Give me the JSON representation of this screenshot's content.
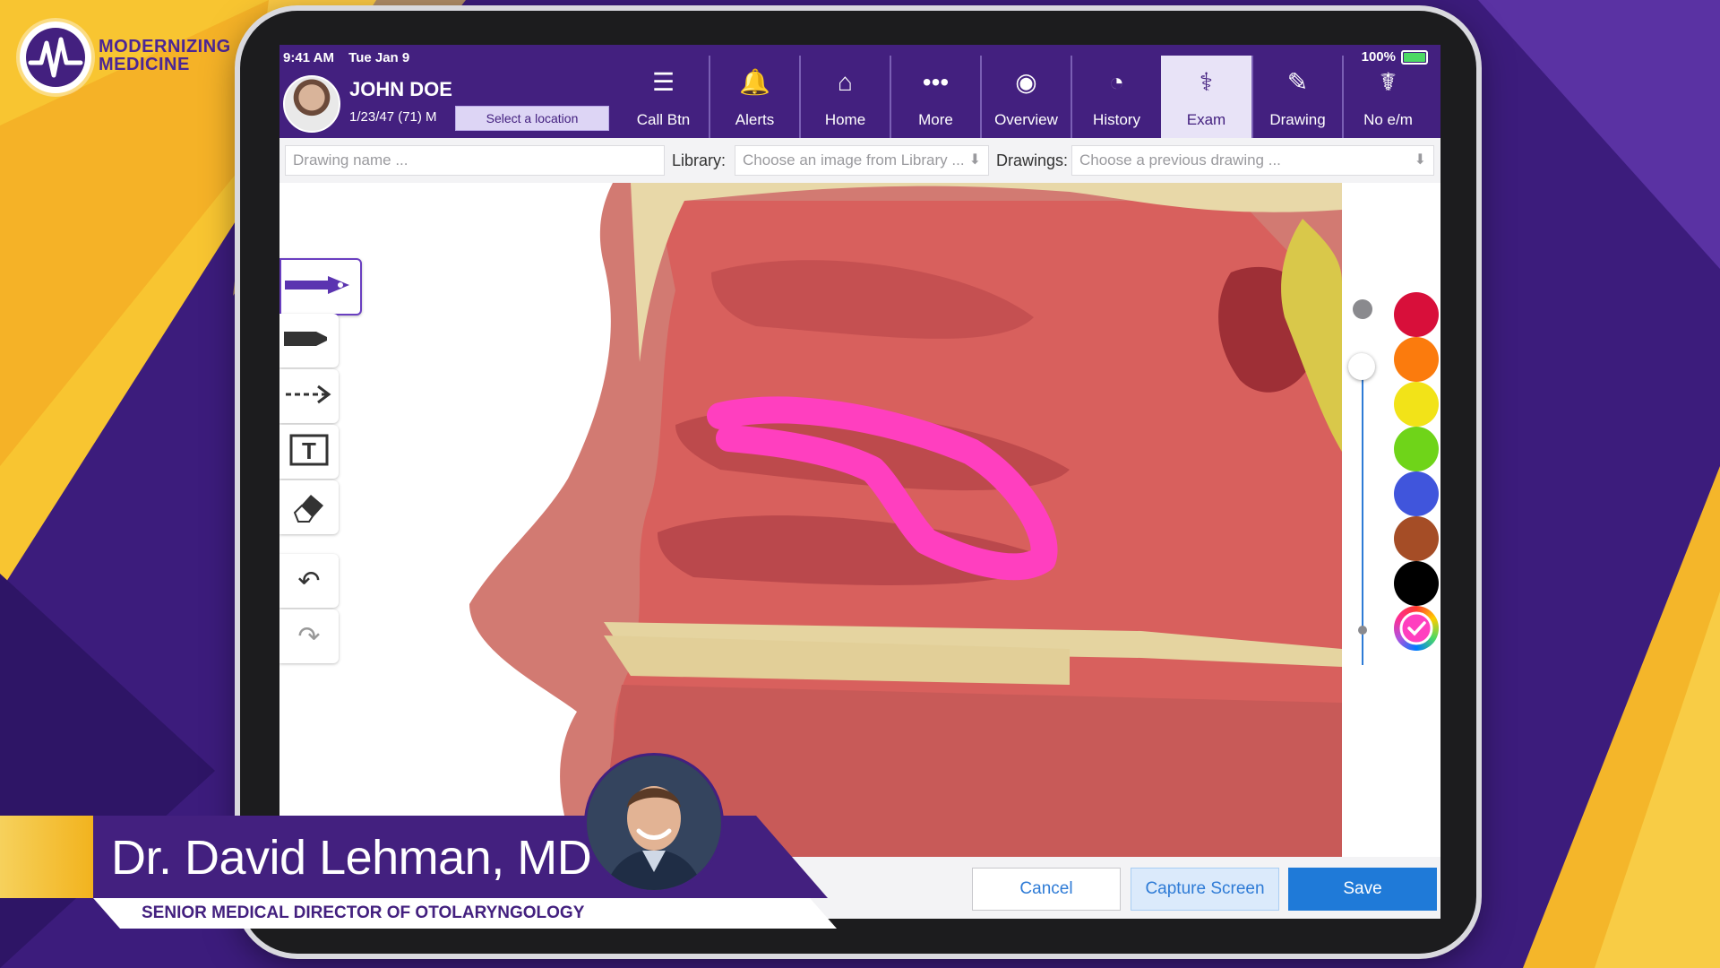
{
  "brand": {
    "logo_line1": "MODERNIZING",
    "logo_line2": "MEDICINE"
  },
  "status": {
    "time": "9:41 AM",
    "date": "Tue Jan 9",
    "battery": "100%"
  },
  "patient": {
    "name": "JOHN DOE",
    "dob": "1/23/47 (71) M",
    "location_button": "Select a location"
  },
  "nav": [
    {
      "label": "Call Btn",
      "icon": "list-icon",
      "glyph": "☰"
    },
    {
      "label": "Alerts",
      "icon": "bell-icon",
      "glyph": "🔔"
    },
    {
      "label": "Home",
      "icon": "home-icon",
      "glyph": "⌂"
    },
    {
      "label": "More",
      "icon": "more-icon",
      "glyph": "•••"
    },
    {
      "label": "Overview",
      "icon": "person-icon",
      "glyph": "◉"
    },
    {
      "label": "History",
      "icon": "clock-icon",
      "glyph": "◔"
    },
    {
      "label": "Exam",
      "icon": "stethoscope-icon",
      "glyph": "⚕",
      "active": true
    },
    {
      "label": "Drawing",
      "icon": "pencil-icon",
      "glyph": "✎"
    },
    {
      "label": "No e/m",
      "icon": "caduceus-icon",
      "glyph": "☤"
    }
  ],
  "toolbar": {
    "drawing_name_placeholder": "Drawing name ...",
    "library_label": "Library:",
    "library_placeholder": "Choose an image from Library ...",
    "drawings_label": "Drawings:",
    "drawings_placeholder": "Choose a previous drawing ..."
  },
  "colors": [
    "#d80f3a",
    "#fb7b0d",
    "#f2e318",
    "#6fd419",
    "#4055dc",
    "#a54d26",
    "#000000"
  ],
  "buttons": {
    "cancel": "Cancel",
    "capture": "Capture Screen",
    "save": "Save"
  },
  "lower_third": {
    "name": "Dr. David Lehman, MD",
    "title": "SENIOR MEDICAL DIRECTOR OF OTOLARYNGOLOGY"
  }
}
